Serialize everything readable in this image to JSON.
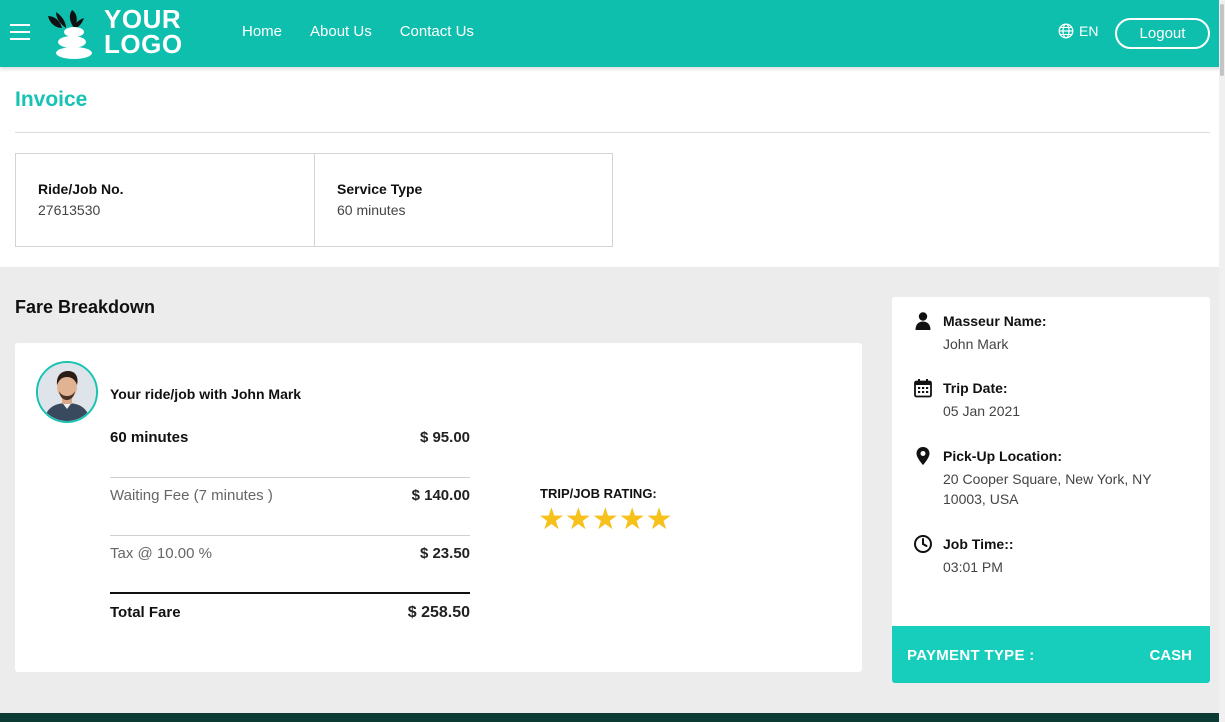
{
  "header": {
    "logo_line1": "YOUR",
    "logo_line2": "LOGO",
    "nav": [
      "Home",
      "About Us",
      "Contact Us"
    ],
    "language": "EN",
    "logout_label": "Logout",
    "brand_color": "#0fbfae"
  },
  "invoice": {
    "title": "Invoice",
    "ride_job_label": "Ride/Job No.",
    "ride_job_value": "27613530",
    "service_type_label": "Service Type",
    "service_type_value": "60 minutes"
  },
  "fare": {
    "heading": "Fare Breakdown",
    "ride_with": "Your ride/job with John Mark",
    "rows": [
      {
        "label": "60 minutes",
        "amount": "$ 95.00"
      },
      {
        "label": "Waiting Fee (7 minutes )",
        "amount": "$ 140.00"
      },
      {
        "label": "Tax @ 10.00 %",
        "amount": "$ 23.50"
      },
      {
        "label": "Total Fare",
        "amount": "$ 258.50"
      }
    ],
    "rating_label": "TRIP/JOB RATING:",
    "rating": 5,
    "rating_max": 5,
    "star_color": "#f7c01a"
  },
  "details": {
    "masseur_label": "Masseur Name:",
    "masseur_value": "John Mark",
    "trip_date_label": "Trip Date:",
    "trip_date_value": "05 Jan 2021",
    "pickup_label": "Pick-Up Location:",
    "pickup_value": "20 Cooper Square, New York, NY 10003, USA",
    "job_time_label": "Job Time::",
    "job_time_value": "03:01 PM",
    "payment_type_label": "PAYMENT TYPE :",
    "payment_type_value": "CASH",
    "accent_color": "#17cdbb"
  },
  "icons": {
    "menu": "hamburger-icon",
    "logo": "stones-leaf-icon",
    "language": "globe-icon",
    "masseur": "user-icon",
    "date": "calendar-icon",
    "location": "map-pin-icon",
    "time": "clock-icon",
    "star": "star-icon"
  }
}
